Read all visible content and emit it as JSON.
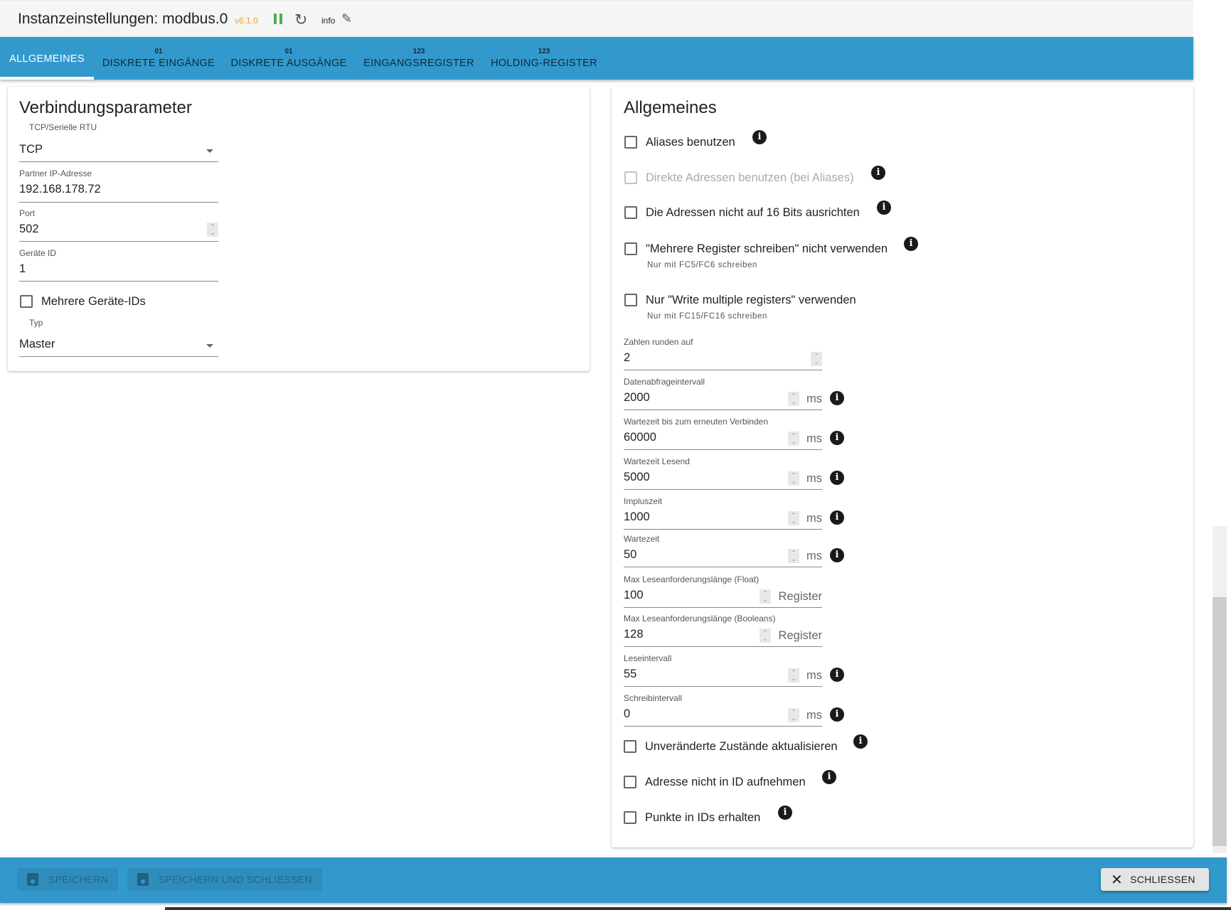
{
  "header": {
    "title": "Instanzeinstellungen: modbus.0",
    "version": "v6.1.0",
    "info_label": "info",
    "icons": [
      "pause-icon",
      "refresh-icon",
      "pencil-icon"
    ]
  },
  "tabs": [
    {
      "label": "ALLGEMEINES",
      "icon": ""
    },
    {
      "label": "DISKRETE EINGÄNGE",
      "icon": "01"
    },
    {
      "label": "DISKRETE AUSGÄNGE",
      "icon": "01"
    },
    {
      "label": "EINGANGSREGISTER",
      "icon": "123"
    },
    {
      "label": "HOLDING-REGISTER",
      "icon": "123"
    }
  ],
  "left": {
    "title": "Verbindungsparameter",
    "mode_label": "TCP/Serielle RTU",
    "mode_value": "TCP",
    "ip_label": "Partner IP-Adresse",
    "ip_value": "192.168.178.72",
    "port_label": "Port",
    "port_value": "502",
    "device_label": "Geräte ID",
    "device_value": "1",
    "multi_label": "Mehrere Geräte-IDs",
    "multi_checked": false,
    "type_label": "Typ",
    "type_value": "Master"
  },
  "right": {
    "title": "Allgemeines",
    "checks": [
      {
        "label": "Aliases benutzen",
        "checked": false
      },
      {
        "label": "Direkte Adressen benutzen (bei Aliases)",
        "checked": false,
        "disabled": true
      },
      {
        "label": "Die Adressen nicht auf 16 Bits ausrichten",
        "checked": false
      },
      {
        "label": "\"Mehrere Register schreiben\" nicht verwenden",
        "sub": "Nur mit FC5/FC6 schreiben",
        "checked": false
      },
      {
        "label": "Nur \"Write multiple registers\" verwenden",
        "sub": "Nur mit FC15/FC16 schreiben",
        "checked": false
      }
    ],
    "fields": [
      {
        "label": "Zahlen runden auf",
        "value": "2",
        "unit": ""
      },
      {
        "label": "Datenabfrageintervall",
        "value": "2000",
        "unit": "ms"
      },
      {
        "label": "Wartezeit bis zum erneuten Verbinden",
        "value": "60000",
        "unit": "ms"
      },
      {
        "label": "Wartezeit Lesend",
        "value": "5000",
        "unit": "ms"
      },
      {
        "label": "Impluszeit",
        "value": "1000",
        "unit": "ms"
      },
      {
        "label": "Wartezeit",
        "value": "50",
        "unit": "ms"
      },
      {
        "label": "Max Leseanforderungslänge (Float)",
        "value": "100",
        "unit": "Register"
      },
      {
        "label": "Max Leseanforderungslänge (Booleans)",
        "value": "128",
        "unit": "Register"
      },
      {
        "label": "Leseintervall",
        "value": "55",
        "unit": "ms"
      },
      {
        "label": "Schreibintervall",
        "value": "0",
        "unit": "ms"
      }
    ],
    "checks2": [
      {
        "label": "Unveränderte Zustände aktualisieren",
        "checked": false
      },
      {
        "label": "Adresse nicht in ID aufnehmen",
        "checked": false
      },
      {
        "label": "Punkte in IDs erhalten",
        "checked": false
      }
    ]
  },
  "footer": {
    "save": "SPEICHERN",
    "save_close": "SPEICHERN UND SCHLIESSEN",
    "close": "SCHLIESSEN"
  },
  "colors": {
    "primary": "#3399cc",
    "version": "#f0a030",
    "running": "#4caf50"
  }
}
